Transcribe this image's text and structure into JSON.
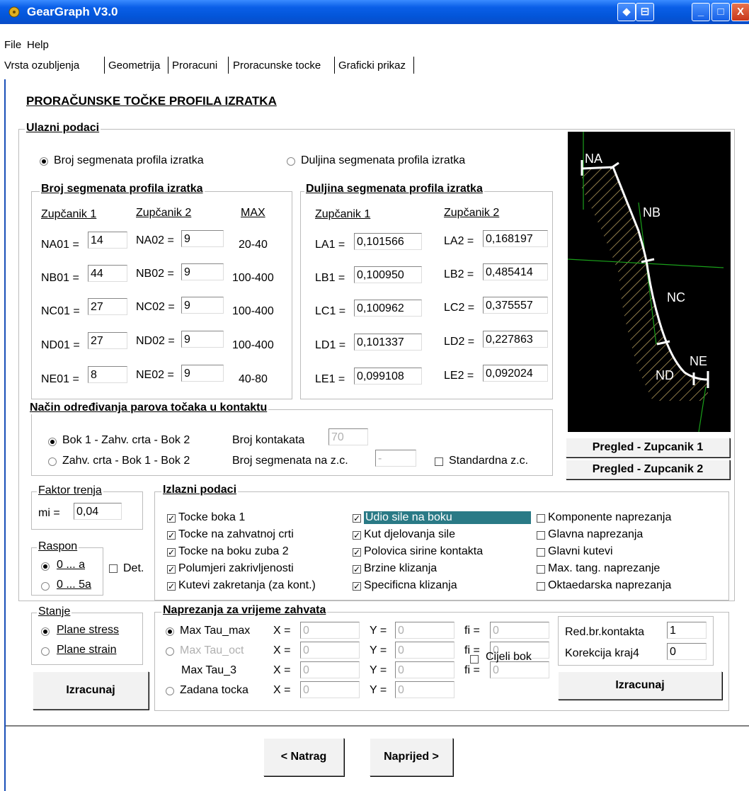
{
  "window": {
    "title": "GearGraph V3.0"
  },
  "menu": [
    "File",
    "Help"
  ],
  "tabs": [
    "Vrsta ozubljenja",
    "Geometrija",
    "Proracuni",
    "Proracunske tocke",
    "Graficki prikaz"
  ],
  "heading": "PRORAČUNSKE TOČKE PROFILA IZRATKA",
  "ulazni": {
    "title": "Ulazni podaci",
    "radio_broj": "Broj segmenata profila izratka",
    "radio_duljina": "Duljina segmenata profila izratka",
    "broj_group": {
      "title": "Broj segmenata profila izratka",
      "col1": "Zupčanik 1",
      "col2": "Zupčanik 2",
      "col3": "MAX",
      "rows": [
        {
          "l1": "NA01 =",
          "v1": "14",
          "l2": "NA02 =",
          "v2": "9",
          "max": "20-40"
        },
        {
          "l1": "NB01 =",
          "v1": "44",
          "l2": "NB02 =",
          "v2": "9",
          "max": "100-400"
        },
        {
          "l1": "NC01 =",
          "v1": "27",
          "l2": "NC02 =",
          "v2": "9",
          "max": "100-400"
        },
        {
          "l1": "ND01 =",
          "v1": "27",
          "l2": "ND02 =",
          "v2": "9",
          "max": "100-400"
        },
        {
          "l1": "NE01 =",
          "v1": "8",
          "l2": "NE02 =",
          "v2": "9",
          "max": "40-80"
        }
      ]
    },
    "duljina_group": {
      "title": "Duljina segmenata profila izratka",
      "col1": "Zupčanik 1",
      "col2": "Zupčanik 2",
      "rows": [
        {
          "l1": "LA1 =",
          "v1": "0,101566",
          "l2": "LA2 =",
          "v2": "0,168197"
        },
        {
          "l1": "LB1 =",
          "v1": "0,100950",
          "l2": "LB2 =",
          "v2": "0,485414"
        },
        {
          "l1": "LC1 =",
          "v1": "0,100962",
          "l2": "LC2 =",
          "v2": "0,375557"
        },
        {
          "l1": "LD1 =",
          "v1": "0,101337",
          "l2": "LD2 =",
          "v2": "0,227863"
        },
        {
          "l1": "LE1 =",
          "v1": "0,099108",
          "l2": "LE2 =",
          "v2": "0,092024"
        }
      ]
    },
    "nacin": {
      "title": "Način određivanja parova točaka u kontaktu",
      "opt1": "Bok 1 - Zahv. crta - Bok 2",
      "opt2": "Zahv. crta - Bok 1 - Bok 2",
      "broj_kontakata_label": "Broj kontakata",
      "broj_kontakata_value": "70",
      "broj_seg_label": "Broj segmenata na z.c.",
      "broj_seg_value": "-",
      "standardna": "Standardna z.c."
    },
    "preview": {
      "labels": [
        "NA",
        "NB",
        "NC",
        "ND",
        "NE"
      ]
    },
    "btn_z1": "Pregled - Zupcanik 1",
    "btn_z2": "Pregled - Zupcanik 2"
  },
  "faktor": {
    "title": "Faktor trenja",
    "label": "mi =",
    "value": "0,04"
  },
  "raspon": {
    "title": "Raspon",
    "opt1": "0 ... a",
    "opt2": "0 ... 5a",
    "det": "Det."
  },
  "stanje": {
    "title": "Stanje",
    "opt1": "Plane stress",
    "opt2": "Plane strain"
  },
  "izracunaj_left": "Izracunaj",
  "izlazni": {
    "title": "Izlazni podaci",
    "col1": [
      "Tocke boka 1",
      "Tocke na zahvatnoj crti",
      "Tocke na boku zuba 2",
      "Polumjeri zakrivljenosti",
      "Kutevi zakretanja (za kont.)"
    ],
    "col2": [
      "Udio sile na boku",
      "Kut djelovanja sile",
      "Polovica sirine kontakta",
      "Brzine klizanja",
      "Specificna klizanja"
    ],
    "col3": [
      "Komponente naprezanja",
      "Glavna naprezanja",
      "Glavni kutevi",
      "Max. tang. naprezanje",
      "Oktaedarska naprezanja"
    ]
  },
  "naprezanja": {
    "title": "Naprezanja za vrijeme zahvata",
    "rows": [
      {
        "label": "Max Tau_max",
        "x": "0",
        "y": "0",
        "fi": "0"
      },
      {
        "label": "Max Tau_oct",
        "x": "0",
        "y": "0",
        "fi": "0"
      },
      {
        "label": "Max Tau_3",
        "x": "0",
        "y": "0",
        "fi": "0"
      },
      {
        "label": "Zadana tocka",
        "x": "0",
        "y": "0"
      }
    ],
    "xl": "X =",
    "yl": "Y =",
    "fil": "fi =",
    "cijeli_bok": "Cijeli bok",
    "red_br_label": "Red.br.kontakta",
    "red_br_value": "1",
    "korekcija_label": "Korekcija kraj4",
    "korekcija_value": "0",
    "izracunaj": "Izracunaj"
  },
  "nav": {
    "back": "< Natrag",
    "next": "Naprijed >"
  }
}
